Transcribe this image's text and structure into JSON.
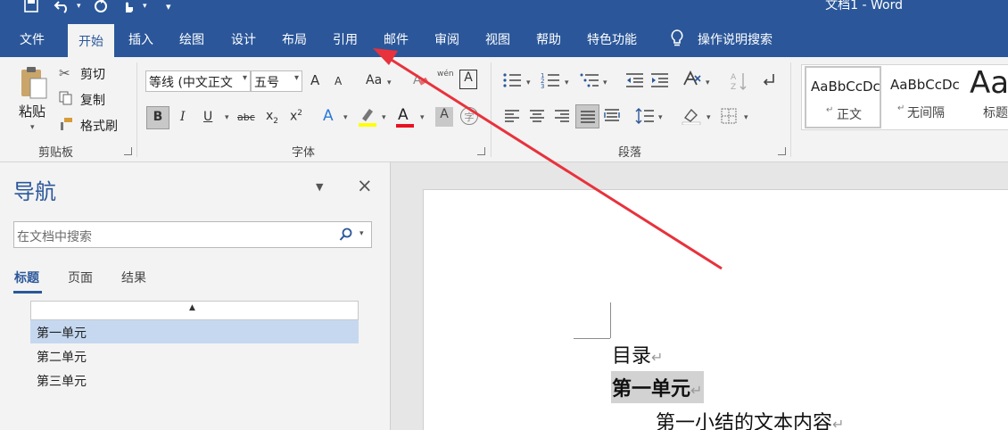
{
  "window": {
    "title": "文档1  -  Word"
  },
  "quick_access": {
    "icons": [
      "save-icon",
      "undo-icon",
      "redo-icon",
      "touch-mode-icon",
      "customize-icon"
    ]
  },
  "tabs": [
    "文件",
    "开始",
    "插入",
    "绘图",
    "设计",
    "布局",
    "引用",
    "邮件",
    "审阅",
    "视图",
    "帮助",
    "特色功能"
  ],
  "active_tab": "开始",
  "tell_me": {
    "label": "操作说明搜索"
  },
  "clipboard": {
    "paste": "粘贴",
    "cut": "剪切",
    "copy": "复制",
    "format_painter": "格式刷",
    "group_label": "剪贴板"
  },
  "font": {
    "name": "等线 (中文正文",
    "size": "五号",
    "grow": "A",
    "shrink": "A",
    "change_case": "Aa",
    "phonetic": "wén",
    "char_border": "A",
    "bold": "B",
    "italic": "I",
    "underline": "U",
    "strike": "abc",
    "subscript": "x",
    "sub_mark": "2",
    "superscript": "x",
    "sup_mark": "2",
    "font_color": "A",
    "char_shading": "A",
    "enclose": "字",
    "group_label": "字体"
  },
  "paragraph": {
    "group_label": "段落"
  },
  "styles": {
    "items": [
      {
        "sample": "AaBbCcDc",
        "name": "正文"
      },
      {
        "sample": "AaBbCcDc",
        "name": "无间隔"
      },
      {
        "sample": "Aa",
        "name": "标题"
      }
    ],
    "para_mark": "↵"
  },
  "nav": {
    "title": "导航",
    "search_placeholder": "在文档中搜索",
    "tabs": [
      "标题",
      "页面",
      "结果"
    ],
    "headings": [
      "第一单元",
      "第二单元",
      "第三单元"
    ]
  },
  "document": {
    "toc": "目录",
    "heading1": "第一单元",
    "body1": "第一小结的文本内容",
    "para_mark": "↵"
  },
  "colors": {
    "accent": "#2b579a",
    "highlight": "#ffff00",
    "font_red": "#e81123",
    "arrow": "#e8323c"
  }
}
